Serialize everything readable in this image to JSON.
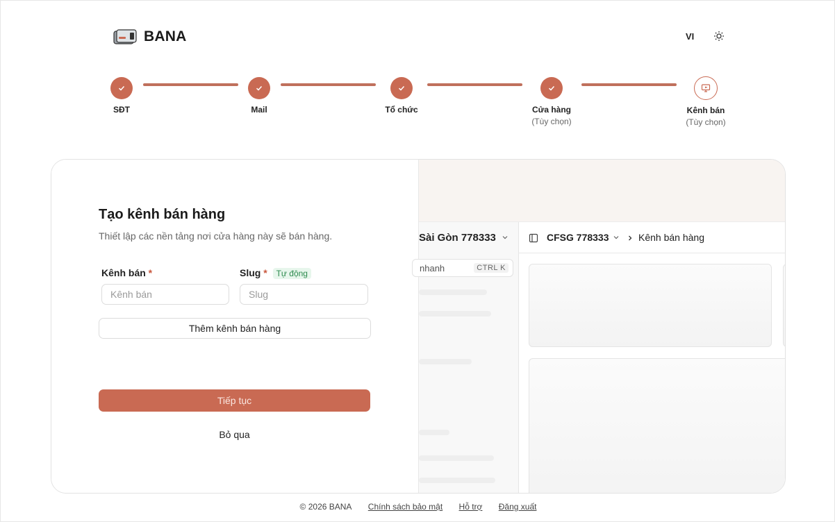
{
  "header": {
    "brand": "BANA",
    "language": "VI",
    "theme_icon": "sun-icon",
    "logo_icon": "card-logo-icon"
  },
  "stepper": {
    "steps": [
      {
        "label": "SĐT",
        "sub": "",
        "status": "completed"
      },
      {
        "label": "Mail",
        "sub": "",
        "status": "completed"
      },
      {
        "label": "Tổ chức",
        "sub": "",
        "status": "completed"
      },
      {
        "label": "Cửa hàng",
        "sub": "(Tùy chọn)",
        "status": "completed"
      },
      {
        "label": "Kênh bán",
        "sub": "(Tùy chọn)",
        "status": "current"
      }
    ],
    "accent": "#c96a53"
  },
  "form": {
    "title": "Tạo kênh bán hàng",
    "subtitle": "Thiết lập các nền tảng nơi cửa hàng này sẽ bán hàng.",
    "channel_label": "Kênh bán",
    "channel_required": "*",
    "channel_placeholder": "Kênh bán",
    "slug_label": "Slug",
    "slug_required": "*",
    "slug_badge": "Tự động",
    "slug_placeholder": "Slug",
    "add_button": "Thêm kênh bán hàng",
    "continue_button": "Tiếp tục",
    "skip_button": "Bỏ qua"
  },
  "preview": {
    "store_name": "Sài Gòn 778333",
    "search_text": "nhanh",
    "search_shortcut": "CTRL K",
    "breadcrumb_store": "CFSG 778333",
    "breadcrumb_page": "Kênh bán hàng"
  },
  "footer": {
    "copyright": "© 2026 BANA",
    "privacy": "Chính sách bảo mật",
    "support": "Hỗ trợ",
    "logout": "Đăng xuất"
  }
}
